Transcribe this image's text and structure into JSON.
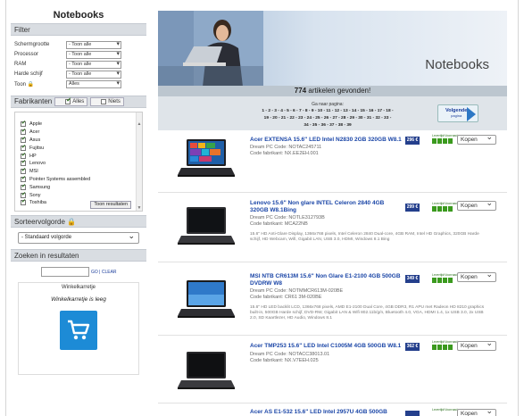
{
  "sidebar": {
    "title": "Notebooks",
    "filter_header": "Filter",
    "filters": [
      {
        "label": "Schermgrootte",
        "value": "- Toon alle"
      },
      {
        "label": "Processor",
        "value": "- Toon alle"
      },
      {
        "label": "RAM",
        "value": "- Toon alle"
      },
      {
        "label": "Harde schijf",
        "value": "- Toon alle"
      },
      {
        "label": "Toon",
        "value": "Alles"
      }
    ],
    "fabrikanten_header": "Fabrikanten",
    "fab_all": "Alles",
    "fab_none": "Niets",
    "brands": [
      "Apple",
      "Acer",
      "Asus",
      "Fujitsu",
      "HP",
      "Lenovo",
      "MSI",
      "Pointer Systems assembled",
      "Samsung",
      "Sony",
      "Toshiba"
    ],
    "toon_resultaten": "Toon resultaten",
    "sort_header": "Sorteervolgorde",
    "sort_value": "- Standaard volgorde",
    "zoek_header": "Zoeken in resultaten",
    "zoek_button": "GO | CLEAR",
    "cart_title": "Winkelkarretje",
    "cart_empty": "Winkelkarretje is leeg"
  },
  "banner": {
    "title": "Notebooks"
  },
  "results": {
    "count": "774",
    "count_text": "artikelen gevonden!",
    "goto_label": "Ga naar pagina:",
    "pages_line1": "1 - 2 - 3 - 4 - 5 - 6 - 7 - 8 - 9 - 10 - 11 - 12 - 13 - 14 - 15 - 16 - 17 - 18 -",
    "pages_line2": "19 - 20 - 21 - 22 - 23 - 24 - 25 - 26 - 27 - 28 - 29 - 30 - 31 - 32 - 33 -",
    "pages_line3": "34 - 35 - 36 - 37 - 38 - 39",
    "next_label": "Volgende",
    "next_sub": "pagina"
  },
  "products": [
    {
      "title": "Acer EXTENSA 15.6\" LED Intel N2830 2GB 320GB W8.1",
      "code_dream": "Dream PC Code: NOTAC245711",
      "code_fab": "Code fabrikant: NX.EE2EH.001",
      "desc": "",
      "price": "296 €",
      "kopen": "Kopen"
    },
    {
      "title": "Lenovo 15.6\" Non glare INTEL Celeron 2840 4GB 320GB W8.1Bing",
      "code_dream": "Dream PC Code: NOTLE312793B",
      "code_fab": "Code fabrikant: MCA22NB",
      "desc": "15.6\" HD Anti-Glare Display, 1366x768 pixels, Intel Celeron 2840 Dual-core, 4GB RAM, Intel HD Graphics, 320GB Harde schijf, HD Webcam, Wifi, Gigabit LAN, USB 3.0, HDMI, Windows 8.1 Bing",
      "price": "299 €",
      "kopen": "Kopen"
    },
    {
      "title": "MSI NTB CR613M 15.6\" Non Glare E1-2100 4GB 500GB DVDRW W8",
      "code_dream": "Dream PC Code: NOTMMCR613M-020BE",
      "code_fab": "Code fabrikant: CR61 3M-020BE",
      "desc": "15.6\" HD LED backlit LCD, 1366x768 pixels, AMD E1-2100 Dual Core, 4GB DDR3, R1 APU met Radeon HD 8210 graphics built-in, 500GB Harde schijf, DVD-RW, Gigabit LAN & Wifi 802.11b/g/n, Bluetooth 4.0, VGA, HDMI 1.4, 1x USB 3.0, 2x USB 2.0, SD Kaartlezer, HD Audio, Windows 8.1",
      "price": "349 €",
      "kopen": "Kopen"
    },
    {
      "title": "Acer TMP253 15.6\" LED Intel C1005M 4GB 500GB W8.1",
      "code_dream": "Dream PC Code: NOTACC38013.01",
      "code_fab": "Code fabrikant: NX.V7EEH.025",
      "desc": "",
      "price": "362 €",
      "kopen": "Kopen"
    },
    {
      "title": "Acer AS E1-532 15.6\" LED Intel 2957U 4GB 500GB",
      "code_dream": "",
      "code_fab": "",
      "desc": "",
      "price": "",
      "kopen": "Kopen"
    }
  ],
  "stock_label": "Levertijd/Voorraad",
  "colors": {
    "link": "#1b46a7",
    "price_bg": "#243f8c",
    "stock": "#3b9a1e",
    "cart": "#1d8bd6"
  }
}
